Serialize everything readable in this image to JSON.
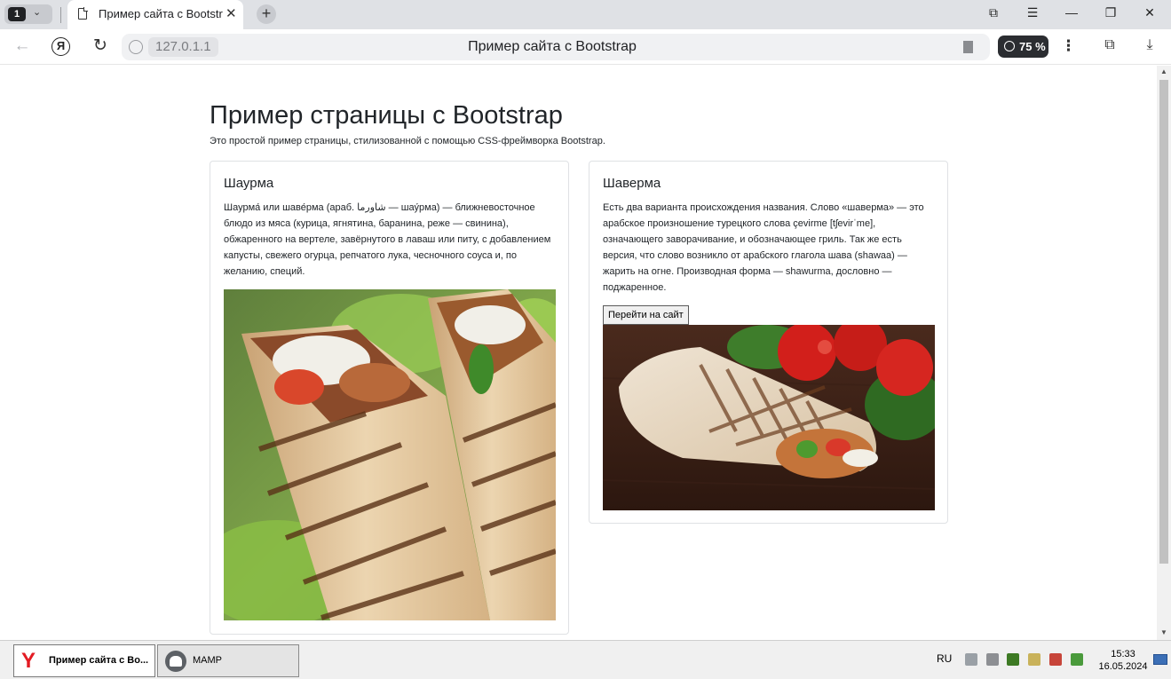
{
  "browser": {
    "tab_count": "1",
    "tab_title": "Пример сайта с Bootstrap",
    "url": "127.0.1.1",
    "page_title": "Пример сайта с Bootstrap",
    "zoom": "75 %"
  },
  "page": {
    "heading": "Пример страницы с Bootstrap",
    "lead": "Это простой пример страницы, стилизованной с помощью CSS-фреймворка Bootstrap.",
    "cards": [
      {
        "title": "Шаурма",
        "text": "Шаурма́ или шаве́рма (араб. شاورما — шау́рма) — ближневосточное блюдо из мяса (курица, ягнятина, баранина, реже — свинина), обжаренного на вертеле, завёрнутого в лаваш или питу, с добавлением капусты, свежего огурца, репчатого лука, чесночного соуса и, по желанию, специй."
      },
      {
        "title": "Шаверма",
        "text": "Есть два варианта происхождения названия. Слово «шаверма» — это арабское произношение турецкого слова çevirme [tʃevirˈme], означающего заворачивание, и обозначающее гриль. Так же есть версия, что слово возникло от арабского глагола шава (shawaa) — жарить на огне. Производная форма — shawurma, дословно — поджаренное.",
        "button": "Перейти на сайт"
      }
    ]
  },
  "taskbar": {
    "apps": [
      {
        "label": "Пример сайта с Bo...",
        "active": true
      },
      {
        "label": "MAMP",
        "active": false
      }
    ],
    "lang": "RU",
    "time": "15:33",
    "date": "16.05.2024"
  }
}
